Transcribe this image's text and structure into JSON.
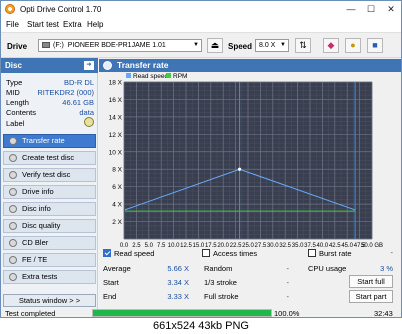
{
  "window": {
    "title": "Opti Drive Control 1.70",
    "minimize": "—",
    "maximize": "☐",
    "close": "✕"
  },
  "menu": [
    "File",
    "Start test",
    "Extra",
    "Help"
  ],
  "toolbar": {
    "drive_label": "Drive",
    "drive_letter": "(F:)",
    "drive_name": "PIONEER BDE-PR1JAME 1.01",
    "speed_label": "Speed",
    "speed_value": "8.0 X"
  },
  "disc": {
    "header": "Disc",
    "rows": [
      {
        "label": "Type",
        "value": "BD-R DL"
      },
      {
        "label": "MID",
        "value": "RITEKDR2 (000)"
      },
      {
        "label": "Length",
        "value": "46.61 GB"
      },
      {
        "label": "Contents",
        "value": "data"
      },
      {
        "label": "Label",
        "value": ""
      }
    ]
  },
  "nav": {
    "items": [
      {
        "label": "Transfer rate",
        "active": true
      },
      {
        "label": "Create test disc",
        "active": false
      },
      {
        "label": "Verify test disc",
        "active": false
      },
      {
        "label": "Drive info",
        "active": false
      },
      {
        "label": "Disc info",
        "active": false
      },
      {
        "label": "Disc quality",
        "active": false
      },
      {
        "label": "CD Bler",
        "active": false
      },
      {
        "label": "FE / TE",
        "active": false
      },
      {
        "label": "Extra tests",
        "active": false
      }
    ],
    "status_window": "Status window > >"
  },
  "panel": {
    "title": "Transfer rate"
  },
  "chart_data": {
    "type": "line",
    "legend": [
      "Read speed",
      "RPM"
    ],
    "legend_colors": {
      "Read speed": "#66aaff",
      "RPM": "#44cc44"
    },
    "xlabel": "",
    "ylabel": "",
    "x_unit": "GB",
    "xlim": [
      0,
      50
    ],
    "ylim": [
      0,
      18
    ],
    "x_ticks": [
      "0.0",
      "2.5",
      "5.0",
      "7.5",
      "10.0",
      "12.5",
      "15.0",
      "17.5",
      "20.0",
      "22.5",
      "25.0",
      "27.5",
      "30.0",
      "32.5",
      "35.0",
      "37.5",
      "40.0",
      "42.5",
      "45.0",
      "47.5",
      "50.0 GB"
    ],
    "y_ticks": [
      "2 X",
      "4 X",
      "6 X",
      "8 X",
      "10 X",
      "12 X",
      "14 X",
      "16 X",
      "18 X"
    ],
    "series": [
      {
        "name": "Read speed",
        "x": [
          0.2,
          23.3,
          46.6
        ],
        "y": [
          3.34,
          8.0,
          3.33
        ],
        "color": "#66aaff"
      },
      {
        "name": "RPM",
        "x": [
          0.2,
          46.6
        ],
        "y": [
          3.2,
          3.2
        ],
        "color": "#44cc44"
      }
    ],
    "markers": [
      23.3,
      46.6
    ],
    "grid": true,
    "background": "#3a3f4f"
  },
  "checks": [
    {
      "label": "Read speed",
      "checked": true
    },
    {
      "label": "Access times",
      "checked": false
    },
    {
      "label": "Burst rate",
      "checked": false
    }
  ],
  "stats": {
    "average_label": "Average",
    "average_value": "5.66 X",
    "start_label": "Start",
    "start_value": "3.34 X",
    "end_label": "End",
    "end_value": "3.33 X",
    "random_label": "Random",
    "random_value": "-",
    "third_label": "1/3 stroke",
    "third_value": "-",
    "full_label": "Full stroke",
    "full_value": "-",
    "cpu_label": "CPU usage",
    "cpu_value": "3 %",
    "burst_value": "-",
    "start_full": "Start full",
    "start_part": "Start part"
  },
  "status": {
    "text": "Test completed",
    "progress": 100,
    "percent": "100.0%",
    "time": "32:43"
  },
  "caption": "661x524  43kb  PNG"
}
